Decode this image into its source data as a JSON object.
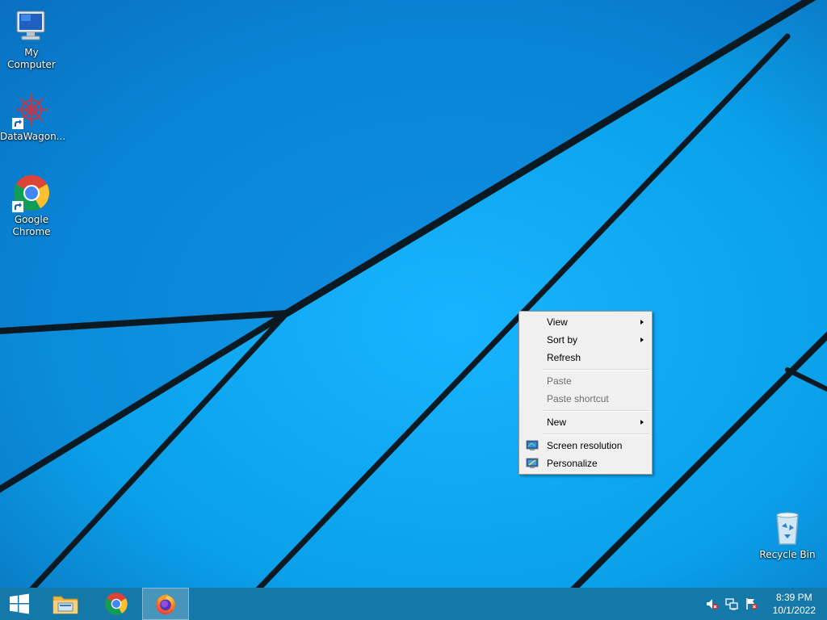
{
  "desktop": {
    "background_color": "#0aa0ea",
    "icons": [
      {
        "label": "My Computer",
        "icon": "computer-icon"
      },
      {
        "label": "DataWagon...",
        "icon": "datawagon-icon",
        "shortcut": true
      },
      {
        "label_line1": "Google",
        "label_line2": "Chrome",
        "icon": "chrome-icon",
        "shortcut": true
      },
      {
        "label": "Recycle Bin",
        "icon": "recycle-bin-icon"
      }
    ]
  },
  "context_menu": {
    "items": [
      {
        "label": "View",
        "submenu": true,
        "enabled": true
      },
      {
        "label": "Sort by",
        "submenu": true,
        "enabled": true
      },
      {
        "label": "Refresh",
        "enabled": true
      },
      {
        "label": "Paste",
        "enabled": false
      },
      {
        "label": "Paste shortcut",
        "enabled": false
      },
      {
        "label": "New",
        "submenu": true,
        "enabled": true
      },
      {
        "label": "Screen resolution",
        "icon": "screen-resolution-icon",
        "enabled": true
      },
      {
        "label": "Personalize",
        "icon": "personalize-icon",
        "enabled": true
      }
    ]
  },
  "taskbar": {
    "buttons": [
      {
        "name": "start",
        "icon": "windows-start-icon"
      },
      {
        "name": "file-explorer",
        "icon": "folder-icon"
      },
      {
        "name": "chrome",
        "icon": "chrome-icon"
      },
      {
        "name": "firefox",
        "icon": "firefox-icon",
        "active": true
      }
    ],
    "tray": {
      "icons": [
        "volume-muted-icon",
        "network-icon",
        "action-center-flag-icon"
      ],
      "time": "8:39 PM",
      "date": "10/1/2022"
    }
  }
}
